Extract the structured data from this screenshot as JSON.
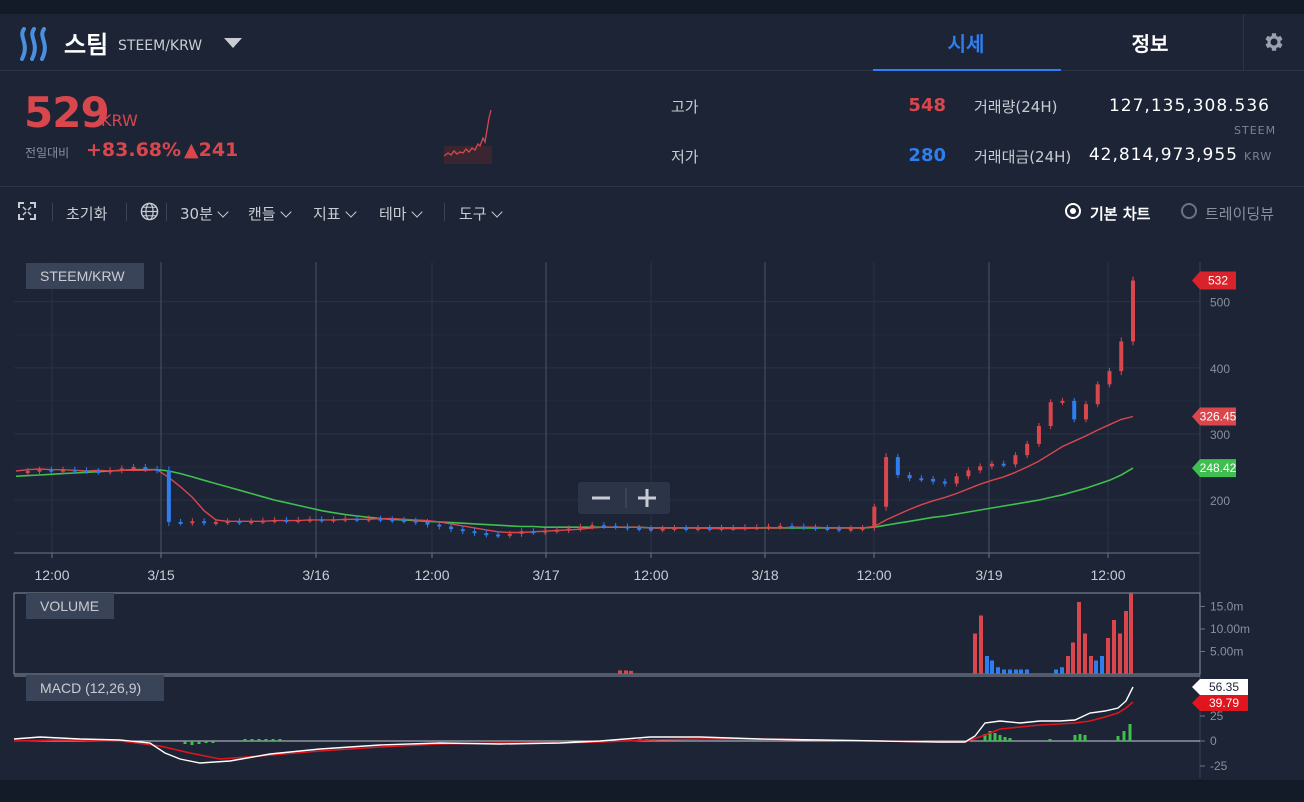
{
  "header": {
    "coin_name": "스팀",
    "pair": "STEEM/KRW",
    "tabs": [
      "시세",
      "정보"
    ]
  },
  "ticker": {
    "price": "529",
    "unit": "KRW",
    "prev_label": "전일대비",
    "change_pct": "+83.68%",
    "change_abs": "▲241",
    "high_label": "고가",
    "high_value": "548",
    "low_label": "저가",
    "low_value": "280",
    "volume_label": "거래량(24H)",
    "volume_value": "127,135,308.536",
    "volume_unit": "STEEM",
    "amount_label": "거래대금(24H)",
    "amount_value": "42,814,973,955",
    "amount_unit": "KRW"
  },
  "toolbar": {
    "reset": "초기화",
    "interval": "30분",
    "candle": "캔들",
    "indicator": "지표",
    "theme": "테마",
    "tools": "도구",
    "basic_chart": "기본 차트",
    "tradingview": "트레이딩뷰"
  },
  "colors": {
    "up": "#d9474d",
    "down": "#2f7ef0",
    "ma_short": "#d9474d",
    "ma_long": "#3fbf4f",
    "macd": "#ffffff",
    "signal": "#e0151d"
  },
  "chart_data": {
    "type": "line",
    "panes": [
      {
        "name": "STEEM/KRW",
        "label": "STEEM/KRW",
        "x_ticks": [
          "12:00",
          "3/15",
          "3/16",
          "12:00",
          "3/17",
          "12:00",
          "3/18",
          "12:00",
          "3/19",
          "12:00"
        ],
        "y_ticks": [
          200,
          300,
          400,
          500
        ],
        "ylim": [
          120,
          560
        ],
        "price": [
          242,
          244,
          246,
          244,
          246,
          245,
          244,
          243,
          245,
          248,
          250,
          247,
          245,
          167,
          166,
          168,
          166,
          167,
          168,
          167,
          168,
          169,
          170,
          169,
          170,
          171,
          170,
          171,
          172,
          171,
          172,
          171,
          170,
          169,
          167,
          163,
          160,
          156,
          153,
          150,
          148,
          147,
          149,
          153,
          152,
          154,
          155,
          157,
          160,
          162,
          161,
          160,
          158,
          157,
          156,
          157,
          158,
          157,
          158,
          157,
          158,
          158,
          159,
          159,
          160,
          161,
          160,
          159,
          158,
          157,
          156,
          157,
          158,
          190,
          265,
          238,
          233,
          232,
          228,
          225,
          236,
          245,
          251,
          255,
          254,
          268,
          285,
          312,
          348,
          350,
          322,
          345,
          375,
          395,
          440,
          532
        ],
        "ma_short": [
          244,
          246,
          247,
          246,
          246,
          245,
          244,
          245,
          244,
          245,
          245,
          245,
          246,
          234,
          220,
          204,
          184,
          170,
          168,
          168,
          168,
          168,
          169,
          169,
          169,
          170,
          170,
          170,
          171,
          171,
          171,
          172,
          172,
          171,
          170,
          169,
          167,
          164,
          161,
          158,
          155,
          152,
          151,
          151,
          152,
          153,
          154,
          155,
          156,
          158,
          159,
          159,
          159,
          159,
          158,
          158,
          158,
          158,
          158,
          157,
          157,
          157,
          157,
          158,
          158,
          158,
          159,
          159,
          159,
          158,
          158,
          158,
          158,
          160,
          170,
          178,
          186,
          193,
          199,
          204,
          210,
          217,
          224,
          230,
          235,
          242,
          250,
          259,
          270,
          281,
          289,
          297,
          306,
          314,
          322,
          326.45
        ],
        "ma_long": [
          236,
          237,
          238,
          239,
          240,
          241,
          242,
          243,
          244,
          245,
          246,
          246,
          246,
          244,
          240,
          235,
          230,
          225,
          220,
          215,
          210,
          205,
          200,
          196,
          192,
          188,
          184,
          181,
          178,
          176,
          174,
          172,
          171,
          170,
          169,
          168,
          167,
          166,
          165,
          164,
          163,
          162,
          161,
          160,
          160,
          159,
          159,
          159,
          159,
          159,
          159,
          159,
          159,
          159,
          158,
          158,
          158,
          158,
          158,
          158,
          158,
          158,
          158,
          158,
          158,
          158,
          158,
          158,
          158,
          158,
          158,
          158,
          158,
          159,
          162,
          165,
          168,
          171,
          174,
          176,
          179,
          182,
          185,
          188,
          191,
          194,
          197,
          200,
          204,
          208,
          213,
          218,
          224,
          230,
          238,
          248.42
        ],
        "last_price_tag": "532",
        "ma_short_tag": "326.45",
        "ma_long_tag": "248.42"
      },
      {
        "name": "VOLUME",
        "label": "VOLUME",
        "y_ticks": [
          "5.00m",
          "10.00m",
          "15.0m"
        ],
        "ylim": [
          0,
          18
        ]
      },
      {
        "name": "MACD (12,26,9)",
        "label": "MACD (12,26,9)",
        "y_ticks": [
          -25,
          0,
          25
        ],
        "macd_tag": "56.35",
        "signal_tag": "39.79"
      }
    ]
  }
}
